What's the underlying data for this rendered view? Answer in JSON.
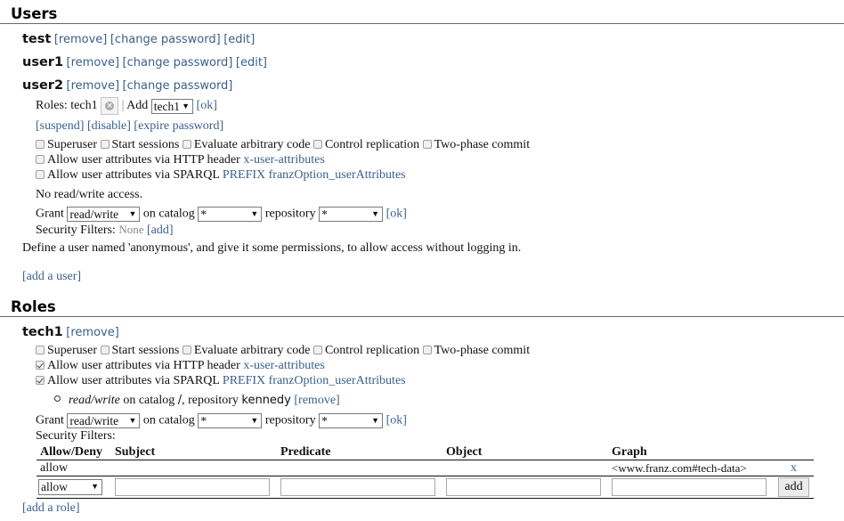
{
  "users_section": {
    "title": "Users",
    "users": [
      {
        "name": "test",
        "links": [
          "[remove]",
          "[change password]",
          "[edit]"
        ]
      },
      {
        "name": "user1",
        "links": [
          "[remove]",
          "[change password]",
          "[edit]"
        ]
      },
      {
        "name": "user2",
        "links": [
          "[remove]",
          "[change password]"
        ]
      }
    ],
    "user2_detail": {
      "roles_label": "Roles: tech1",
      "remove_role_icon": "x-circle-icon",
      "separator": "|",
      "add_label": "Add",
      "add_role_select": "tech1",
      "ok_link": "[ok]",
      "actions": [
        "[suspend]",
        "[disable]",
        "[expire password]"
      ],
      "permissions": [
        {
          "label": "Superuser",
          "checked": false
        },
        {
          "label": "Start sessions",
          "checked": false
        },
        {
          "label": "Evaluate arbitrary code",
          "checked": false
        },
        {
          "label": "Control replication",
          "checked": false
        },
        {
          "label": "Two-phase commit",
          "checked": false
        }
      ],
      "http_attr": {
        "label": "Allow user attributes via HTTP header",
        "link": "x-user-attributes",
        "checked": false
      },
      "sparql_attr": {
        "label": "Allow user attributes via SPARQL",
        "link": "PREFIX franzOption_userAttributes",
        "checked": false
      },
      "access_text": "No read/write access.",
      "grant": {
        "grant_label": "Grant",
        "access_select": "read/write",
        "catalog_label": "on catalog",
        "catalog_select": "*",
        "repository_label": "repository",
        "repository_select": "*",
        "ok_link": "[ok]"
      },
      "security_filters_label": "Security Filters:",
      "security_filters_value": "None",
      "security_filters_add": "[add]"
    },
    "anonymous_hint": "Define a user named 'anonymous', and give it some permissions, to allow access without logging in.",
    "add_user_link": "[add a user]"
  },
  "roles_section": {
    "title": "Roles",
    "role": {
      "name": "tech1",
      "remove_link": "[remove]",
      "permissions": [
        {
          "label": "Superuser",
          "checked": false
        },
        {
          "label": "Start sessions",
          "checked": false
        },
        {
          "label": "Evaluate arbitrary code",
          "checked": false
        },
        {
          "label": "Control replication",
          "checked": false
        },
        {
          "label": "Two-phase commit",
          "checked": false
        }
      ],
      "http_attr": {
        "label": "Allow user attributes via HTTP header",
        "link": "x-user-attributes",
        "checked": true
      },
      "sparql_attr": {
        "label": "Allow user attributes via SPARQL",
        "link": "PREFIX franzOption_userAttributes",
        "checked": true
      },
      "access_item": {
        "mode": "read/write",
        "text_catalog": "on catalog",
        "catalog": "/",
        "text_repo": ", repository",
        "repository": "kennedy",
        "remove_link": "[remove]"
      },
      "grant": {
        "grant_label": "Grant",
        "access_select": "read/write",
        "catalog_label": "on catalog",
        "catalog_select": "*",
        "repository_label": "repository",
        "repository_select": "*",
        "ok_link": "[ok]"
      },
      "security_filters_label": "Security Filters:",
      "filters_table": {
        "headers": [
          "Allow/Deny",
          "Subject",
          "Predicate",
          "Object",
          "Graph"
        ],
        "rows": [
          {
            "allow_deny": "allow",
            "subject": "",
            "predicate": "",
            "object": "",
            "graph": "<www.franz.com#tech-data>",
            "delete": "x"
          }
        ],
        "new_row": {
          "allow_deny_select": "allow",
          "subject": "",
          "predicate": "",
          "object": "",
          "graph": "",
          "add_button": "add"
        }
      }
    },
    "add_role_link": "[add a role]"
  }
}
